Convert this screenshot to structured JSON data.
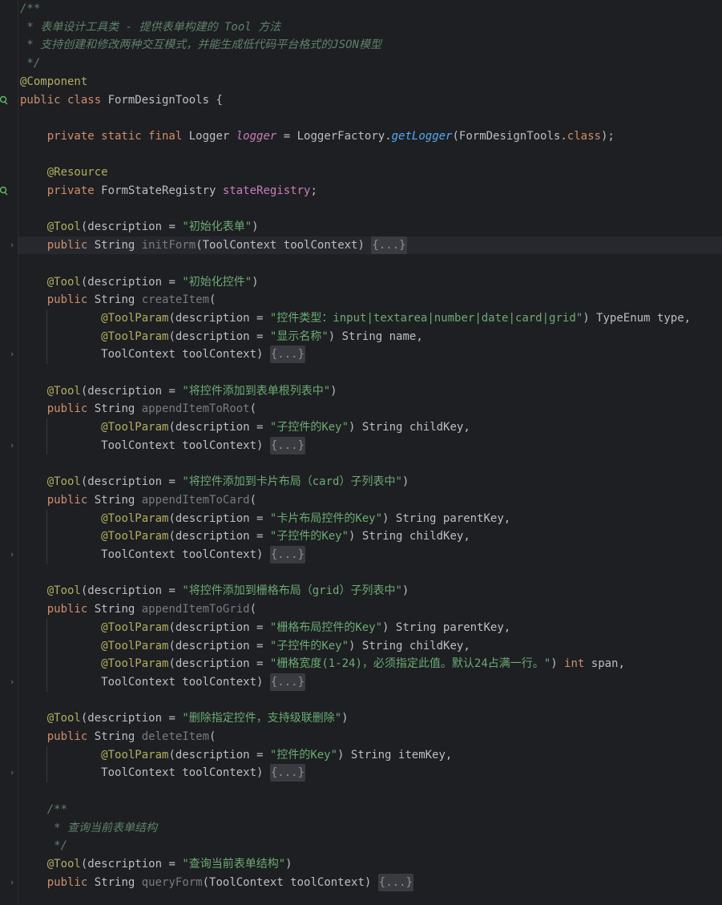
{
  "editor": {
    "language": "java",
    "colors": {
      "background": "#1e1f22",
      "keyword": "#cf8e6d",
      "annotation": "#b3ae60",
      "string": "#6aab73",
      "field": "#c77dbb",
      "doc_comment": "#5f826b",
      "method_call": "#56a8f5",
      "unused": "#777b82",
      "text": "#bcbec4"
    },
    "gutter_icons": [
      "spring-bean-icon",
      "spring-bean-icon"
    ],
    "fold_markers": [
      "fold-arrow-icon"
    ],
    "lines": [
      [
        {
          "t": "/**",
          "c": "doc"
        }
      ],
      [
        {
          "t": " * 表单设计工具类 - 提供表单构建的 Tool 方法",
          "c": "doc"
        }
      ],
      [
        {
          "t": " * 支持创建和修改两种交互模式，并能生成低代码平台格式的JSON模型",
          "c": "doc"
        }
      ],
      [
        {
          "t": " */",
          "c": "doc"
        }
      ],
      [
        {
          "t": "@Component",
          "c": "ann"
        }
      ],
      [
        {
          "t": "public class ",
          "c": "kw"
        },
        {
          "t": "FormDesignTools {",
          "c": "id"
        }
      ],
      [],
      [
        {
          "t": "    "
        },
        {
          "t": "private static final ",
          "c": "kw"
        },
        {
          "t": "Logger ",
          "c": "id"
        },
        {
          "t": "logger",
          "c": "fldi"
        },
        {
          "t": " = LoggerFactory.",
          "c": "id"
        },
        {
          "t": "getLogger",
          "c": "mi"
        },
        {
          "t": "(FormDesignTools.",
          "c": "id"
        },
        {
          "t": "class",
          "c": "kw"
        },
        {
          "t": ");",
          "c": "id"
        }
      ],
      [],
      [
        {
          "t": "    "
        },
        {
          "t": "@Resource",
          "c": "ann"
        }
      ],
      [
        {
          "t": "    "
        },
        {
          "t": "private ",
          "c": "kw"
        },
        {
          "t": "FormStateRegistry ",
          "c": "id"
        },
        {
          "t": "stateRegistry",
          "c": "fld"
        },
        {
          "t": ";",
          "c": "id"
        }
      ],
      [],
      [
        {
          "t": "    "
        },
        {
          "t": "@Tool",
          "c": "ann"
        },
        {
          "t": "(description = ",
          "c": "id"
        },
        {
          "t": "\"初始化表单\"",
          "c": "str"
        },
        {
          "t": ")",
          "c": "id"
        }
      ],
      [
        {
          "t": "    "
        },
        {
          "t": "public ",
          "c": "kw"
        },
        {
          "t": "String ",
          "c": "id"
        },
        {
          "t": "initForm",
          "c": "unused"
        },
        {
          "t": "(ToolContext toolContext) ",
          "c": "id"
        },
        {
          "t": "{...}",
          "c": "collapse"
        }
      ],
      [],
      [
        {
          "t": "    "
        },
        {
          "t": "@Tool",
          "c": "ann"
        },
        {
          "t": "(description = ",
          "c": "id"
        },
        {
          "t": "\"初始化控件\"",
          "c": "str"
        },
        {
          "t": ")",
          "c": "id"
        }
      ],
      [
        {
          "t": "    "
        },
        {
          "t": "public ",
          "c": "kw"
        },
        {
          "t": "String ",
          "c": "id"
        },
        {
          "t": "createItem",
          "c": "unused"
        },
        {
          "t": "(",
          "c": "id"
        }
      ],
      [
        {
          "t": "            "
        },
        {
          "t": "@ToolParam",
          "c": "ann"
        },
        {
          "t": "(description = ",
          "c": "id"
        },
        {
          "t": "\"控件类型：input|textarea|number|date|card|grid\"",
          "c": "str"
        },
        {
          "t": ") TypeEnum type,",
          "c": "id"
        }
      ],
      [
        {
          "t": "            "
        },
        {
          "t": "@ToolParam",
          "c": "ann"
        },
        {
          "t": "(description = ",
          "c": "id"
        },
        {
          "t": "\"显示名称\"",
          "c": "str"
        },
        {
          "t": ") String name,",
          "c": "id"
        }
      ],
      [
        {
          "t": "            "
        },
        {
          "t": "ToolContext toolContext) ",
          "c": "id"
        },
        {
          "t": "{...}",
          "c": "collapse"
        }
      ],
      [],
      [
        {
          "t": "    "
        },
        {
          "t": "@Tool",
          "c": "ann"
        },
        {
          "t": "(description = ",
          "c": "id"
        },
        {
          "t": "\"将控件添加到表单根列表中\"",
          "c": "str"
        },
        {
          "t": ")",
          "c": "id"
        }
      ],
      [
        {
          "t": "    "
        },
        {
          "t": "public ",
          "c": "kw"
        },
        {
          "t": "String ",
          "c": "id"
        },
        {
          "t": "appendItemToRoot",
          "c": "unused"
        },
        {
          "t": "(",
          "c": "id"
        }
      ],
      [
        {
          "t": "            "
        },
        {
          "t": "@ToolParam",
          "c": "ann"
        },
        {
          "t": "(description = ",
          "c": "id"
        },
        {
          "t": "\"子控件的Key\"",
          "c": "str"
        },
        {
          "t": ") String childKey,",
          "c": "id"
        }
      ],
      [
        {
          "t": "            "
        },
        {
          "t": "ToolContext toolContext) ",
          "c": "id"
        },
        {
          "t": "{...}",
          "c": "collapse"
        }
      ],
      [],
      [
        {
          "t": "    "
        },
        {
          "t": "@Tool",
          "c": "ann"
        },
        {
          "t": "(description = ",
          "c": "id"
        },
        {
          "t": "\"将控件添加到卡片布局（card）子列表中\"",
          "c": "str"
        },
        {
          "t": ")",
          "c": "id"
        }
      ],
      [
        {
          "t": "    "
        },
        {
          "t": "public ",
          "c": "kw"
        },
        {
          "t": "String ",
          "c": "id"
        },
        {
          "t": "appendItemToCard",
          "c": "unused"
        },
        {
          "t": "(",
          "c": "id"
        }
      ],
      [
        {
          "t": "            "
        },
        {
          "t": "@ToolParam",
          "c": "ann"
        },
        {
          "t": "(description = ",
          "c": "id"
        },
        {
          "t": "\"卡片布局控件的Key\"",
          "c": "str"
        },
        {
          "t": ") String parentKey,",
          "c": "id"
        }
      ],
      [
        {
          "t": "            "
        },
        {
          "t": "@ToolParam",
          "c": "ann"
        },
        {
          "t": "(description = ",
          "c": "id"
        },
        {
          "t": "\"子控件的Key\"",
          "c": "str"
        },
        {
          "t": ") String childKey,",
          "c": "id"
        }
      ],
      [
        {
          "t": "            "
        },
        {
          "t": "ToolContext toolContext) ",
          "c": "id"
        },
        {
          "t": "{...}",
          "c": "collapse"
        }
      ],
      [],
      [
        {
          "t": "    "
        },
        {
          "t": "@Tool",
          "c": "ann"
        },
        {
          "t": "(description = ",
          "c": "id"
        },
        {
          "t": "\"将控件添加到栅格布局（grid）子列表中\"",
          "c": "str"
        },
        {
          "t": ")",
          "c": "id"
        }
      ],
      [
        {
          "t": "    "
        },
        {
          "t": "public ",
          "c": "kw"
        },
        {
          "t": "String ",
          "c": "id"
        },
        {
          "t": "appendItemToGrid",
          "c": "unused"
        },
        {
          "t": "(",
          "c": "id"
        }
      ],
      [
        {
          "t": "            "
        },
        {
          "t": "@ToolParam",
          "c": "ann"
        },
        {
          "t": "(description = ",
          "c": "id"
        },
        {
          "t": "\"栅格布局控件的Key\"",
          "c": "str"
        },
        {
          "t": ") String parentKey,",
          "c": "id"
        }
      ],
      [
        {
          "t": "            "
        },
        {
          "t": "@ToolParam",
          "c": "ann"
        },
        {
          "t": "(description = ",
          "c": "id"
        },
        {
          "t": "\"子控件的Key\"",
          "c": "str"
        },
        {
          "t": ") String childKey,",
          "c": "id"
        }
      ],
      [
        {
          "t": "            "
        },
        {
          "t": "@ToolParam",
          "c": "ann"
        },
        {
          "t": "(description = ",
          "c": "id"
        },
        {
          "t": "\"栅格宽度(1-24)，必须指定此值。默认24占满一行。\"",
          "c": "str"
        },
        {
          "t": ") ",
          "c": "id"
        },
        {
          "t": "int ",
          "c": "kw"
        },
        {
          "t": "span,",
          "c": "id"
        }
      ],
      [
        {
          "t": "            "
        },
        {
          "t": "ToolContext toolContext) ",
          "c": "id"
        },
        {
          "t": "{...}",
          "c": "collapse"
        }
      ],
      [],
      [
        {
          "t": "    "
        },
        {
          "t": "@Tool",
          "c": "ann"
        },
        {
          "t": "(description = ",
          "c": "id"
        },
        {
          "t": "\"删除指定控件，支持级联删除\"",
          "c": "str"
        },
        {
          "t": ")",
          "c": "id"
        }
      ],
      [
        {
          "t": "    "
        },
        {
          "t": "public ",
          "c": "kw"
        },
        {
          "t": "String ",
          "c": "id"
        },
        {
          "t": "deleteItem",
          "c": "unused"
        },
        {
          "t": "(",
          "c": "id"
        }
      ],
      [
        {
          "t": "            "
        },
        {
          "t": "@ToolParam",
          "c": "ann"
        },
        {
          "t": "(description = ",
          "c": "id"
        },
        {
          "t": "\"控件的Key\"",
          "c": "str"
        },
        {
          "t": ") String itemKey,",
          "c": "id"
        }
      ],
      [
        {
          "t": "            "
        },
        {
          "t": "ToolContext toolContext) ",
          "c": "id"
        },
        {
          "t": "{...}",
          "c": "collapse"
        }
      ],
      [],
      [
        {
          "t": "    "
        },
        {
          "t": "/**",
          "c": "doc"
        }
      ],
      [
        {
          "t": "    "
        },
        {
          "t": " * 查询当前表单结构",
          "c": "doc"
        }
      ],
      [
        {
          "t": "    "
        },
        {
          "t": " */",
          "c": "doc"
        }
      ],
      [
        {
          "t": "    "
        },
        {
          "t": "@Tool",
          "c": "ann"
        },
        {
          "t": "(description = ",
          "c": "id"
        },
        {
          "t": "\"查询当前表单结构\"",
          "c": "str"
        },
        {
          "t": ")",
          "c": "id"
        }
      ],
      [
        {
          "t": "    "
        },
        {
          "t": "public ",
          "c": "kw"
        },
        {
          "t": "String ",
          "c": "id"
        },
        {
          "t": "queryForm",
          "c": "unused"
        },
        {
          "t": "(ToolContext toolContext) ",
          "c": "id"
        },
        {
          "t": "{...}",
          "c": "collapse"
        }
      ]
    ]
  }
}
